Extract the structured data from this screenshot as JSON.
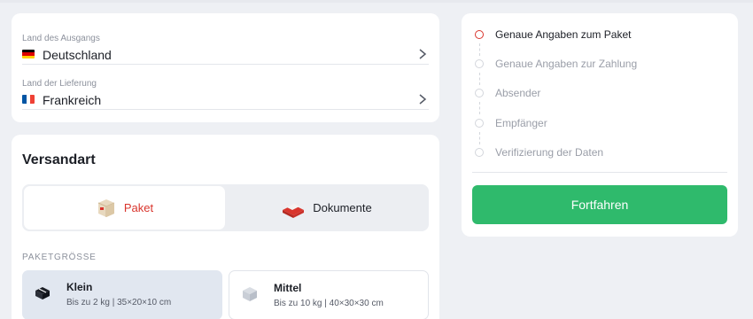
{
  "route": {
    "origin": {
      "label": "Land des Ausgangs",
      "value": "Deutschland",
      "flag": "flag-de-icon"
    },
    "destination": {
      "label": "Land der Lieferung",
      "value": "Frankreich",
      "flag": "flag-fr-icon"
    }
  },
  "shipping": {
    "title": "Versandart",
    "types": [
      {
        "label": "Paket",
        "icon": "parcel-box-icon",
        "selected": true
      },
      {
        "label": "Dokumente",
        "icon": "documents-icon",
        "selected": false
      }
    ],
    "size_caption": "PAKETGRÖSSE",
    "sizes": [
      {
        "name": "Klein",
        "desc": "Bis zu 2 kg | 35×20×10 cm",
        "icon": "small-box-icon",
        "selected": true
      },
      {
        "name": "Mittel",
        "desc": "Bis zu 10 kg | 40×30×30 cm",
        "icon": "medium-box-icon",
        "selected": false
      }
    ]
  },
  "steps": [
    {
      "label": "Genaue Angaben zum Paket",
      "active": true
    },
    {
      "label": "Genaue Angaben zur Zahlung",
      "active": false
    },
    {
      "label": "Absender",
      "active": false
    },
    {
      "label": "Empfänger",
      "active": false
    },
    {
      "label": "Verifizierung der Daten",
      "active": false
    }
  ],
  "cta": {
    "label": "Fortfahren"
  },
  "colors": {
    "accent_red": "#d9352d",
    "primary_green": "#2fba6c",
    "background": "#eef0f4"
  }
}
